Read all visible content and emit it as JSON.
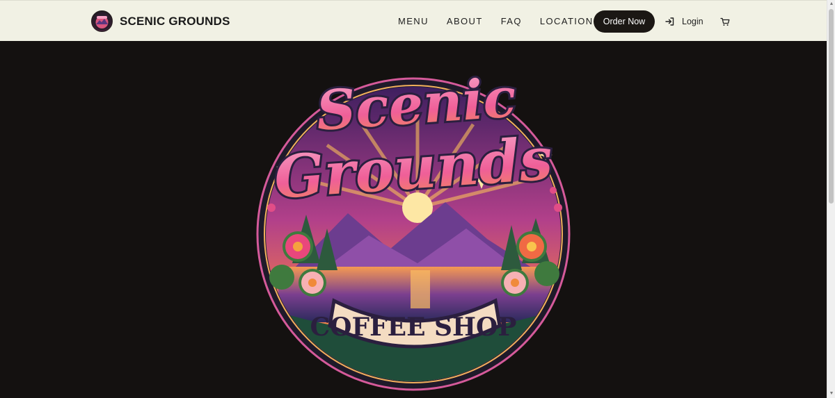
{
  "header": {
    "brand_name": "SCENIC GROUNDS",
    "nav": [
      {
        "label": "MENU"
      },
      {
        "label": "ABOUT"
      },
      {
        "label": "FAQ"
      },
      {
        "label": "LOCATION"
      }
    ],
    "order_button": "Order Now",
    "login_label": "Login",
    "icons": {
      "login": "login-arrow-icon",
      "cart": "cart-icon",
      "logo": "scenic-grounds-logo"
    }
  },
  "hero": {
    "logo_title_line1": "Scenic",
    "logo_title_line2": "Grounds",
    "logo_banner": "COFFEE SHOP"
  },
  "colors": {
    "header_bg": "#f1f1e4",
    "hero_bg": "#141110",
    "button_bg": "#1b1714",
    "title_pink": "#f06aa0",
    "sunset_orange": "#f49a3c",
    "mountain_purple": "#6c3d8f"
  }
}
